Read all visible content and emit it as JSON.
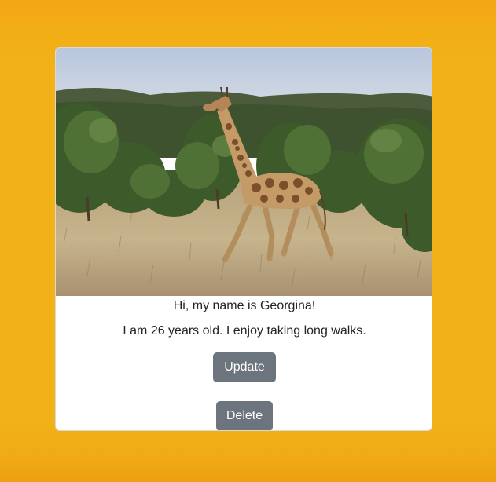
{
  "profile": {
    "greeting": "Hi, my name is Georgina!",
    "bio": "I am 26 years old. I enjoy taking long walks.",
    "photo_subject": "giraffe-walking-in-savanna"
  },
  "actions": {
    "update_label": "Update",
    "delete_label": "Delete"
  },
  "colors": {
    "background": "#f2b117",
    "card": "#ffffff",
    "button": "#6c757d",
    "text": "#212529"
  }
}
